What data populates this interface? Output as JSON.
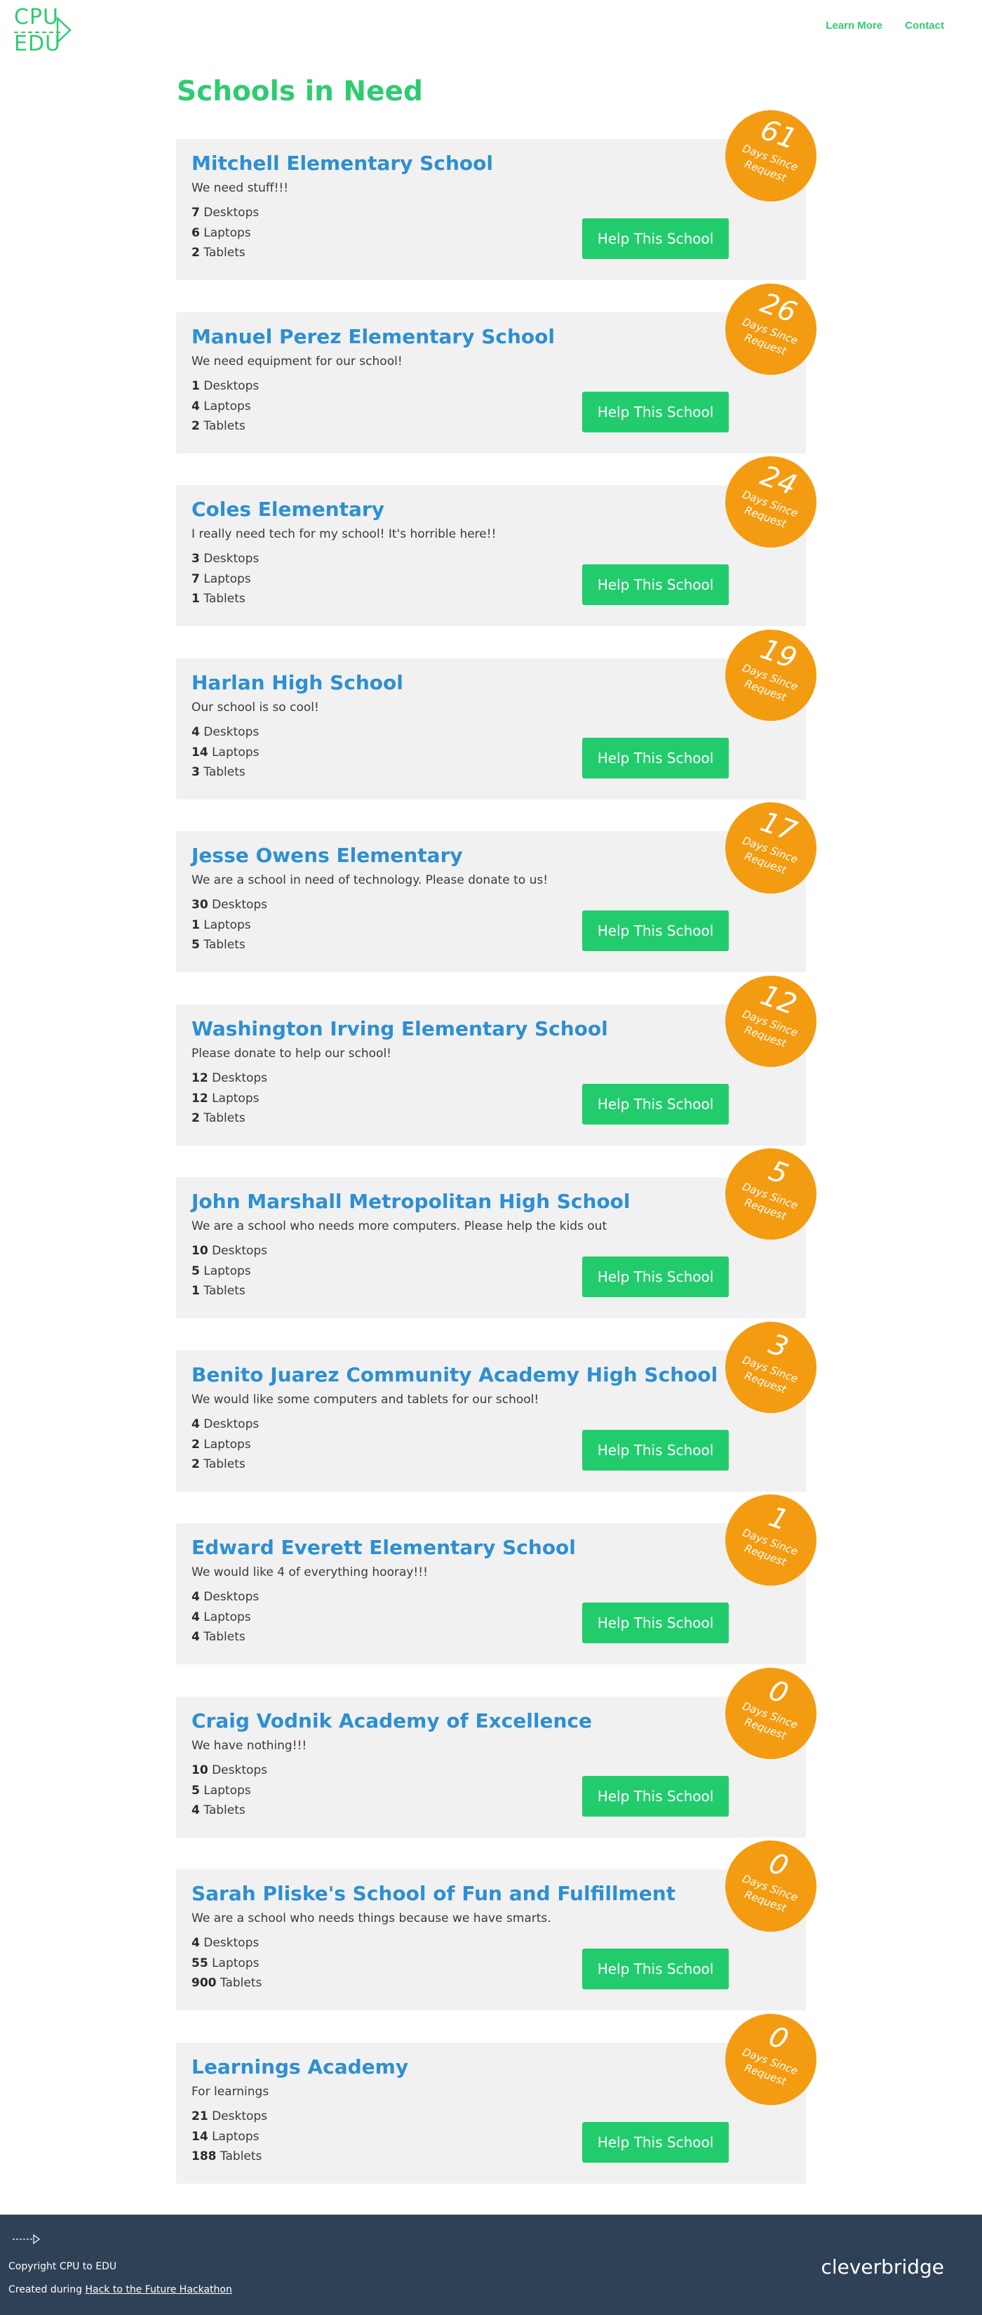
{
  "header": {
    "logo_top": "CPU",
    "logo_bottom": "EDU",
    "nav": [
      "Learn More",
      "Contact"
    ]
  },
  "page_title": "Schools in Need",
  "help_label": "Help This School",
  "badge_label": "Days Since Request",
  "units": {
    "desktops": "Desktops",
    "laptops": "Laptops",
    "tablets": "Tablets"
  },
  "schools": [
    {
      "name": "Mitchell Elementary School",
      "desc": "We need stuff!!!",
      "desktops": "7",
      "laptops": "6",
      "tablets": "2",
      "days": "61"
    },
    {
      "name": "Manuel Perez Elementary School",
      "desc": "We need equipment for our school!",
      "desktops": "1",
      "laptops": "4",
      "tablets": "2",
      "days": "26"
    },
    {
      "name": "Coles Elementary",
      "desc": "I really need tech for my school! It's horrible here!!",
      "desktops": "3",
      "laptops": "7",
      "tablets": "1",
      "days": "24"
    },
    {
      "name": "Harlan High School",
      "desc": "Our school is so cool!",
      "desktops": "4",
      "laptops": "14",
      "tablets": "3",
      "days": "19"
    },
    {
      "name": "Jesse Owens Elementary",
      "desc": "We are a school in need of technology. Please donate to us!",
      "desktops": "30",
      "laptops": "1",
      "tablets": "5",
      "days": "17"
    },
    {
      "name": "Washington Irving Elementary School",
      "desc": "Please donate to help our school!",
      "desktops": "12",
      "laptops": "12",
      "tablets": "2",
      "days": "12"
    },
    {
      "name": "John Marshall Metropolitan High School",
      "desc": "We are a school who needs more computers. Please help the kids out",
      "desktops": "10",
      "laptops": "5",
      "tablets": "1",
      "days": "5"
    },
    {
      "name": "Benito Juarez Community Academy High School",
      "desc": "We would like some computers and tablets for our school!",
      "desktops": "4",
      "laptops": "2",
      "tablets": "2",
      "days": "3"
    },
    {
      "name": "Edward Everett Elementary School",
      "desc": "We would like 4 of everything hooray!!!",
      "desktops": "4",
      "laptops": "4",
      "tablets": "4",
      "days": "1"
    },
    {
      "name": "Craig Vodnik Academy of Excellence",
      "desc": "We have nothing!!!",
      "desktops": "10",
      "laptops": "5",
      "tablets": "4",
      "days": "0"
    },
    {
      "name": "Sarah Pliske's School of Fun and Fulfillment",
      "desc": "We are a school who needs things because we have smarts.",
      "desktops": "4",
      "laptops": "55",
      "tablets": "900",
      "days": "0"
    },
    {
      "name": "Learnings Academy",
      "desc": "For learnings",
      "desktops": "21",
      "laptops": "14",
      "tablets": "188",
      "days": "0"
    }
  ],
  "footer": {
    "copyright": "Copyright CPU to EDU",
    "created_prefix": "Created during",
    "created_link": "Hack to the Future Hackathon",
    "sponsor": "cleverbridge"
  },
  "colors": {
    "accent": "#2ecc71",
    "title_blue": "#2e8fd1",
    "badge": "#f39c12",
    "footer_bg": "#2f4157"
  },
  "icons": [
    "logo-arrow-icon",
    "footer-arrow-icon"
  ]
}
